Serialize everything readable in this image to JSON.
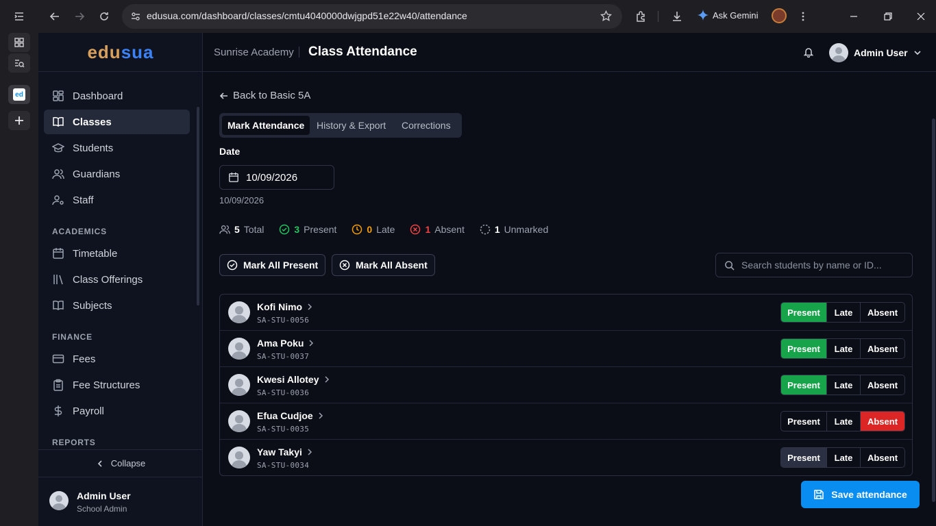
{
  "browser": {
    "url": "edusua.com/dashboard/classes/cmtu4040000dwjgpd51e22w40/attendance",
    "ask_gemini": "Ask Gemini"
  },
  "sidebar": {
    "logo_a": "edu",
    "logo_b": "sua",
    "items": [
      {
        "label": "Dashboard",
        "icon": "dashboard-icon"
      },
      {
        "label": "Classes",
        "icon": "book-icon",
        "active": true
      },
      {
        "label": "Students",
        "icon": "graduation-cap-icon"
      },
      {
        "label": "Guardians",
        "icon": "users-icon"
      },
      {
        "label": "Staff",
        "icon": "user-cog-icon"
      }
    ],
    "academics_label": "ACADEMICS",
    "academics": [
      {
        "label": "Timetable",
        "icon": "calendar-icon"
      },
      {
        "label": "Class Offerings",
        "icon": "library-icon"
      },
      {
        "label": "Subjects",
        "icon": "book-icon"
      }
    ],
    "finance_label": "FINANCE",
    "finance": [
      {
        "label": "Fees",
        "icon": "credit-card-icon"
      },
      {
        "label": "Fee Structures",
        "icon": "clipboard-icon"
      },
      {
        "label": "Payroll",
        "icon": "dollar-icon"
      }
    ],
    "reports_label": "REPORTS",
    "collapse": "Collapse",
    "user_name": "Admin User",
    "user_role": "School Admin"
  },
  "header": {
    "school": "Sunrise Academy",
    "title": "Class Attendance",
    "user": "Admin User"
  },
  "main": {
    "back": "Back to Basic 5A",
    "tabs": [
      "Mark Attendance",
      "History & Export",
      "Corrections"
    ],
    "date_label": "Date",
    "date_value": "10/09/2026",
    "date_hint": "10/09/2026",
    "stats": {
      "total": "5",
      "total_label": "Total",
      "present": "3",
      "present_label": "Present",
      "late": "0",
      "late_label": "Late",
      "absent": "1",
      "absent_label": "Absent",
      "unmarked": "1",
      "unmarked_label": "Unmarked"
    },
    "mark_all_present": "Mark All Present",
    "mark_all_absent": "Mark All Absent",
    "search_placeholder": "Search students by name or ID...",
    "options": {
      "present": "Present",
      "late": "Late",
      "absent": "Absent"
    },
    "students": [
      {
        "name": "Kofi Nimo",
        "id": "SA-STU-0056",
        "status": "present"
      },
      {
        "name": "Ama Poku",
        "id": "SA-STU-0037",
        "status": "present"
      },
      {
        "name": "Kwesi Allotey",
        "id": "SA-STU-0036",
        "status": "present"
      },
      {
        "name": "Efua Cudjoe",
        "id": "SA-STU-0035",
        "status": "absent"
      },
      {
        "name": "Yaw Takyi",
        "id": "SA-STU-0034",
        "status": "unmarked"
      }
    ],
    "save": "Save attendance"
  },
  "colors": {
    "present": "#16a34a",
    "absent": "#dc2626",
    "late": "#f59e0b",
    "primary": "#0a8df0"
  }
}
